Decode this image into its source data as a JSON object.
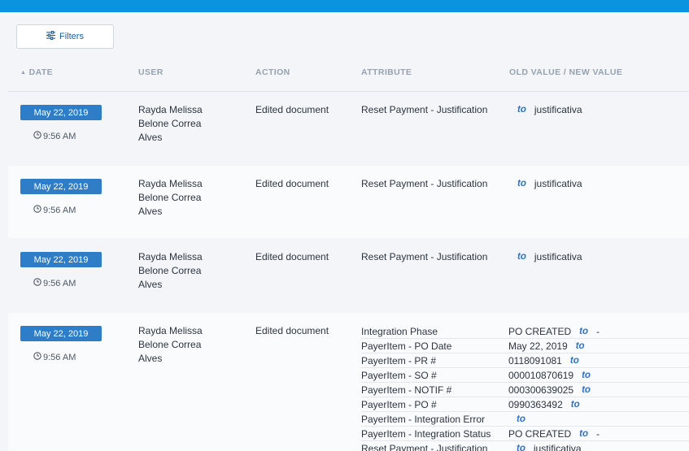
{
  "filters_label": "Filters",
  "headers": {
    "date": "DATE",
    "user": "USER",
    "action": "ACTION",
    "attribute": "ATTRIBUTE",
    "values": "OLD VALUE / NEW VALUE",
    "date_sort_icon": "sort-up-icon"
  },
  "to_word": "to",
  "rows": [
    {
      "date": "May 22, 2019",
      "time": "9:56 AM",
      "user_lines": [
        "Rayda Melissa",
        "Belone Correa",
        "Alves"
      ],
      "action": "Edited document",
      "changes": [
        {
          "attribute": "Reset Payment - Justification",
          "old": "",
          "new": "justificativa"
        }
      ]
    },
    {
      "date": "May 22, 2019",
      "time": "9:56 AM",
      "user_lines": [
        "Rayda Melissa",
        "Belone Correa",
        "Alves"
      ],
      "action": "Edited document",
      "changes": [
        {
          "attribute": "Reset Payment - Justification",
          "old": "",
          "new": "justificativa"
        }
      ]
    },
    {
      "date": "May 22, 2019",
      "time": "9:56 AM",
      "user_lines": [
        "Rayda Melissa",
        "Belone Correa",
        "Alves"
      ],
      "action": "Edited document",
      "changes": [
        {
          "attribute": "Reset Payment - Justification",
          "old": "",
          "new": "justificativa"
        }
      ]
    },
    {
      "date": "May 22, 2019",
      "time": "9:56 AM",
      "user_lines": [
        "Rayda Melissa",
        "Belone Correa",
        "Alves"
      ],
      "action": "Edited document",
      "changes": [
        {
          "attribute": "Integration Phase",
          "old": "PO CREATED",
          "new": "-"
        },
        {
          "attribute": "PayerItem - PO Date",
          "old": "May 22, 2019",
          "new": ""
        },
        {
          "attribute": "PayerItem - PR #",
          "old": "0118091081",
          "new": ""
        },
        {
          "attribute": "PayerItem - SO #",
          "old": "000010870619",
          "new": ""
        },
        {
          "attribute": "PayerItem - NOTIF #",
          "old": "000300639025",
          "new": ""
        },
        {
          "attribute": "PayerItem - PO #",
          "old": "0990363492",
          "new": ""
        },
        {
          "attribute": "PayerItem - Integration Error",
          "old": "",
          "new": ""
        },
        {
          "attribute": "PayerItem - Integration Status",
          "old": "PO CREATED",
          "new": "-"
        },
        {
          "attribute": "Reset Payment - Justification",
          "old": "",
          "new": "justificativa"
        }
      ]
    }
  ],
  "colors": {
    "topbar": "#0b93e0",
    "date_badge": "#2f7dc6",
    "to_text": "#2f6fc6"
  }
}
